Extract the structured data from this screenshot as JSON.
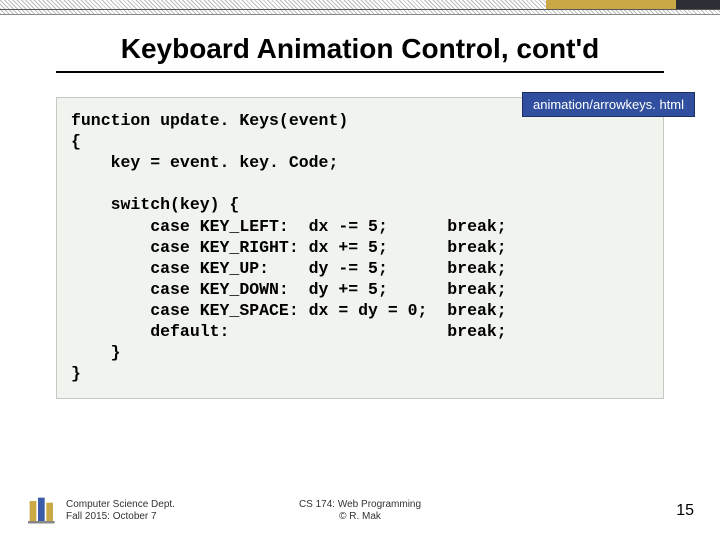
{
  "title": "Keyboard Animation Control, cont'd",
  "file_label": "animation/arrowkeys. html",
  "code": "function update. Keys(event)\n{\n    key = event. key. Code;\n\n    switch(key) {\n        case KEY_LEFT:  dx -= 5;      break;\n        case KEY_RIGHT: dx += 5;      break;\n        case KEY_UP:    dy -= 5;      break;\n        case KEY_DOWN:  dy += 5;      break;\n        case KEY_SPACE: dx = dy = 0;  break;\n        default:                      break;\n    }\n}",
  "footer": {
    "dept_line1": "Computer Science Dept.",
    "dept_line2": "Fall 2015: October 7",
    "course_line1": "CS 174: Web Programming",
    "course_line2": "© R. Mak",
    "page": "15"
  }
}
